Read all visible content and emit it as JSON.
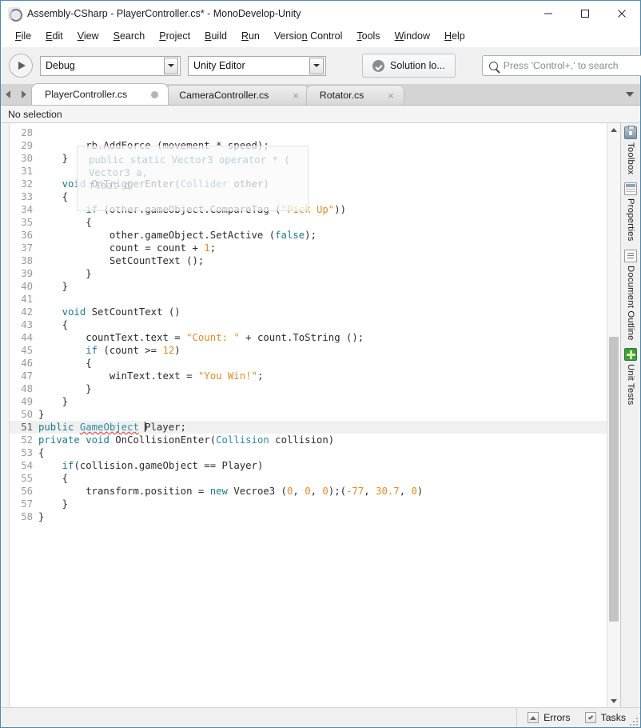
{
  "window": {
    "title": "Assembly-CSharp - PlayerController.cs* - MonoDevelop-Unity",
    "app_icon": "monodevelop-icon",
    "minimize_label": "minimize-icon",
    "maximize_label": "maximize-icon",
    "close_label": "close-icon"
  },
  "menubar": {
    "items": [
      {
        "label": "File",
        "mnemonic": "F",
        "rest": "ile"
      },
      {
        "label": "Edit",
        "mnemonic": "E",
        "rest": "dit"
      },
      {
        "label": "View",
        "mnemonic": "V",
        "rest": "iew"
      },
      {
        "label": "Search",
        "mnemonic": "S",
        "rest": "earch"
      },
      {
        "label": "Project",
        "mnemonic": "P",
        "rest": "roject"
      },
      {
        "label": "Build",
        "mnemonic": "B",
        "rest": "uild"
      },
      {
        "label": "Run",
        "mnemonic": "R",
        "rest": "un"
      },
      {
        "label": "Version Control",
        "mnemonic": "",
        "rest": "Version Control"
      },
      {
        "label": "Tools",
        "mnemonic": "T",
        "rest": "ools"
      },
      {
        "label": "Window",
        "mnemonic": "W",
        "rest": "indow"
      },
      {
        "label": "Help",
        "mnemonic": "H",
        "rest": "elp"
      }
    ]
  },
  "toolbar": {
    "run_button": "run-icon",
    "configuration": "Debug",
    "target": "Unity Editor",
    "solution_status": "Solution lo...",
    "search_placeholder": "Press 'Control+,' to search"
  },
  "tabs": {
    "nav_prev": "prev-tab-arrow",
    "nav_next": "next-tab-arrow",
    "overflow": "tab-overflow-arrow",
    "items": [
      {
        "label": "PlayerController.cs",
        "active": true,
        "modified": true,
        "close": "×"
      },
      {
        "label": "CameraController.cs",
        "active": false,
        "modified": false,
        "close": "×"
      },
      {
        "label": "Rotator.cs",
        "active": false,
        "modified": false,
        "close": "×"
      }
    ]
  },
  "breadcrumb": {
    "text": "No selection"
  },
  "tooltip_overlay": {
    "line1": "public static Vector3 operator * (",
    "line2": "Vector3 a,",
    "line3": "float d"
  },
  "editor": {
    "first_line": 28,
    "cursor_line": 51,
    "lines": [
      {
        "n": 28,
        "parts": []
      },
      {
        "n": 29,
        "parts": [
          {
            "t": "        rb.AddForce (movement * speed);",
            "c": "plain"
          }
        ]
      },
      {
        "n": 30,
        "parts": [
          {
            "t": "    }",
            "c": "plain"
          }
        ]
      },
      {
        "n": 31,
        "parts": []
      },
      {
        "n": 32,
        "parts": [
          {
            "t": "    ",
            "c": "plain"
          },
          {
            "t": "void",
            "c": "kw"
          },
          {
            "t": " OnTriggerEnter(",
            "c": "plain"
          },
          {
            "t": "Collider",
            "c": "typ"
          },
          {
            "t": " other)",
            "c": "plain"
          }
        ]
      },
      {
        "n": 33,
        "parts": [
          {
            "t": "    {",
            "c": "plain"
          }
        ]
      },
      {
        "n": 34,
        "parts": [
          {
            "t": "        ",
            "c": "plain"
          },
          {
            "t": "if",
            "c": "kw"
          },
          {
            "t": " (other.gameObject.CompareTag (",
            "c": "plain"
          },
          {
            "t": "\"Pick Up\"",
            "c": "str"
          },
          {
            "t": "))",
            "c": "plain"
          }
        ]
      },
      {
        "n": 35,
        "parts": [
          {
            "t": "        {",
            "c": "plain"
          }
        ]
      },
      {
        "n": 36,
        "parts": [
          {
            "t": "            other.gameObject.SetActive (",
            "c": "plain"
          },
          {
            "t": "false",
            "c": "kw"
          },
          {
            "t": ");",
            "c": "plain"
          }
        ]
      },
      {
        "n": 37,
        "parts": [
          {
            "t": "            count = count + ",
            "c": "plain"
          },
          {
            "t": "1",
            "c": "num"
          },
          {
            "t": ";",
            "c": "plain"
          }
        ]
      },
      {
        "n": 38,
        "parts": [
          {
            "t": "            SetCountText ();",
            "c": "plain"
          }
        ]
      },
      {
        "n": 39,
        "parts": [
          {
            "t": "        }",
            "c": "plain"
          }
        ]
      },
      {
        "n": 40,
        "parts": [
          {
            "t": "    }",
            "c": "plain"
          }
        ]
      },
      {
        "n": 41,
        "parts": []
      },
      {
        "n": 42,
        "parts": [
          {
            "t": "    ",
            "c": "plain"
          },
          {
            "t": "void",
            "c": "kw"
          },
          {
            "t": " SetCountText ()",
            "c": "plain"
          }
        ]
      },
      {
        "n": 43,
        "parts": [
          {
            "t": "    {",
            "c": "plain"
          }
        ]
      },
      {
        "n": 44,
        "parts": [
          {
            "t": "        countText.text = ",
            "c": "plain"
          },
          {
            "t": "\"Count: \"",
            "c": "str"
          },
          {
            "t": " + count.ToString ();",
            "c": "plain"
          }
        ]
      },
      {
        "n": 45,
        "parts": [
          {
            "t": "        ",
            "c": "plain"
          },
          {
            "t": "if",
            "c": "kw"
          },
          {
            "t": " (count >= ",
            "c": "plain"
          },
          {
            "t": "12",
            "c": "num"
          },
          {
            "t": ")",
            "c": "plain"
          }
        ]
      },
      {
        "n": 46,
        "parts": [
          {
            "t": "        {",
            "c": "plain"
          }
        ]
      },
      {
        "n": 47,
        "parts": [
          {
            "t": "            winText.text = ",
            "c": "plain"
          },
          {
            "t": "\"You Win!\"",
            "c": "str"
          },
          {
            "t": ";",
            "c": "plain"
          }
        ]
      },
      {
        "n": 48,
        "parts": [
          {
            "t": "        }",
            "c": "plain"
          }
        ]
      },
      {
        "n": 49,
        "parts": [
          {
            "t": "    }",
            "c": "plain"
          }
        ]
      },
      {
        "n": 50,
        "parts": [
          {
            "t": "}",
            "c": "plain"
          }
        ]
      },
      {
        "n": 51,
        "current": true,
        "parts": [
          {
            "t": "public",
            "c": "kw"
          },
          {
            "t": " ",
            "c": "plain"
          },
          {
            "t": "GameObject",
            "c": "typ err"
          },
          {
            "t": " ",
            "c": "plain"
          },
          {
            "t": "|CARET|",
            "c": "caret"
          },
          {
            "t": "Player;",
            "c": "plain"
          }
        ]
      },
      {
        "n": 52,
        "parts": [
          {
            "t": "private",
            "c": "kw"
          },
          {
            "t": " ",
            "c": "plain"
          },
          {
            "t": "void",
            "c": "kw"
          },
          {
            "t": " OnCollisionEnter(",
            "c": "plain"
          },
          {
            "t": "Collision",
            "c": "typ"
          },
          {
            "t": " collision)",
            "c": "plain"
          }
        ]
      },
      {
        "n": 53,
        "parts": [
          {
            "t": "{",
            "c": "plain"
          }
        ]
      },
      {
        "n": 54,
        "parts": [
          {
            "t": "    ",
            "c": "plain"
          },
          {
            "t": "if",
            "c": "kw"
          },
          {
            "t": "(collision.gameObject == Player)",
            "c": "plain"
          }
        ]
      },
      {
        "n": 55,
        "parts": [
          {
            "t": "    {",
            "c": "plain"
          }
        ]
      },
      {
        "n": 56,
        "parts": [
          {
            "t": "        transform.position = ",
            "c": "plain"
          },
          {
            "t": "new",
            "c": "kw"
          },
          {
            "t": " Vecroe3 (",
            "c": "plain"
          },
          {
            "t": "0",
            "c": "num"
          },
          {
            "t": ", ",
            "c": "plain"
          },
          {
            "t": "0",
            "c": "num"
          },
          {
            "t": ", ",
            "c": "plain"
          },
          {
            "t": "0",
            "c": "num"
          },
          {
            "t": ");(",
            "c": "plain"
          },
          {
            "t": "-77",
            "c": "num"
          },
          {
            "t": ", ",
            "c": "plain"
          },
          {
            "t": "30.7",
            "c": "num"
          },
          {
            "t": ", ",
            "c": "plain"
          },
          {
            "t": "0",
            "c": "num"
          },
          {
            "t": ")",
            "c": "plain"
          }
        ]
      },
      {
        "n": 57,
        "parts": [
          {
            "t": "    }",
            "c": "plain"
          }
        ]
      },
      {
        "n": 58,
        "parts": [
          {
            "t": "}",
            "c": "plain"
          }
        ]
      }
    ]
  },
  "right_dock": {
    "items": [
      {
        "label": "Toolbox",
        "icon": "toolbox-icon",
        "cls": "ico-toolbox"
      },
      {
        "label": "Properties",
        "icon": "properties-icon",
        "cls": "ico-props"
      },
      {
        "label": "Document Outline",
        "icon": "document-outline-icon",
        "cls": "ico-doc"
      },
      {
        "label": "Unit Tests",
        "icon": "unit-tests-icon",
        "cls": "ico-unit"
      }
    ]
  },
  "statusbar": {
    "errors_label": "Errors",
    "tasks_label": "Tasks"
  },
  "colors": {
    "accent_border": "#4a8ab0",
    "keyword": "#1f7a8c",
    "string": "#e08b2e",
    "type": "#2e8b9e",
    "error_underline": "#e05b5b",
    "current_line": "#f0f0f0"
  }
}
